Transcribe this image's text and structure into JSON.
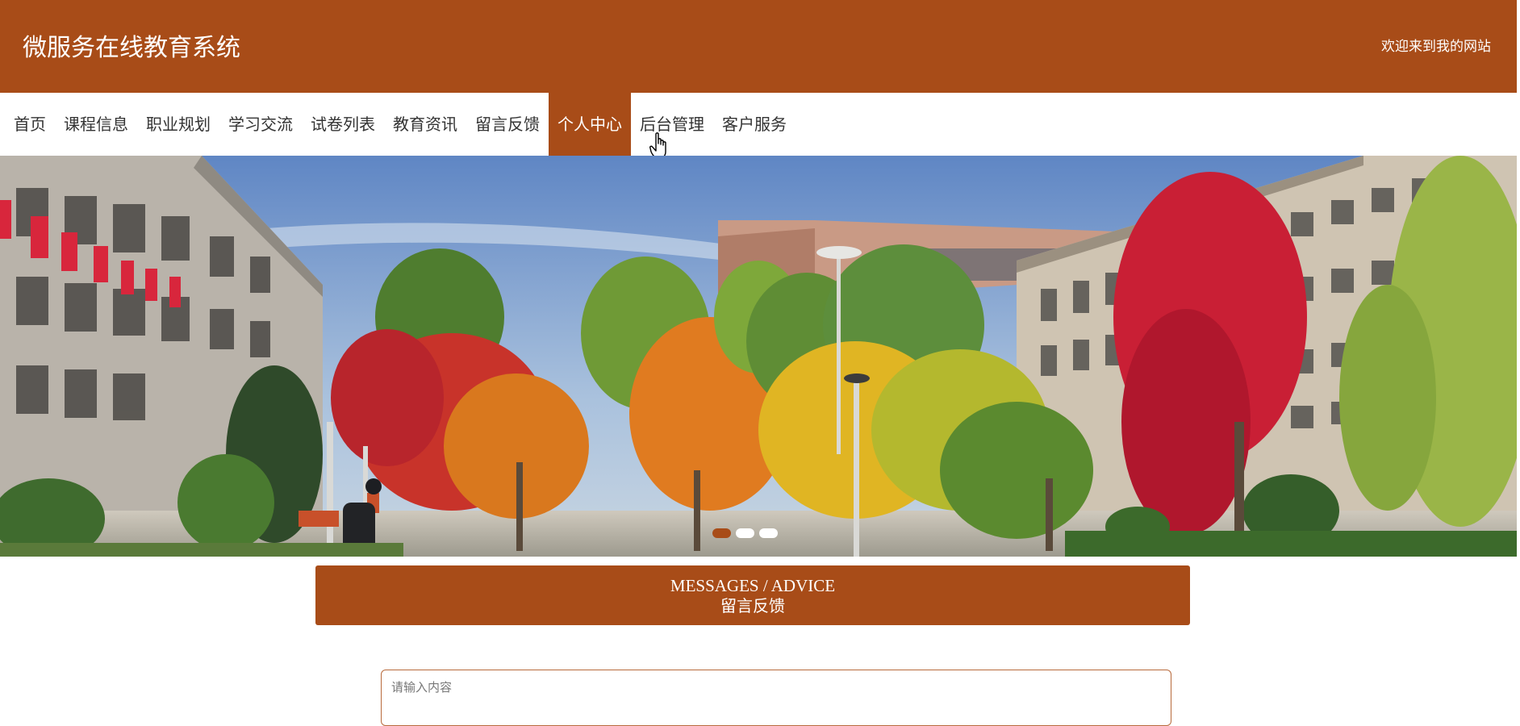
{
  "header": {
    "title": "微服务在线教育系统",
    "welcome": "欢迎来到我的网站"
  },
  "nav": {
    "items": [
      {
        "label": "首页"
      },
      {
        "label": "课程信息"
      },
      {
        "label": "职业规划"
      },
      {
        "label": "学习交流"
      },
      {
        "label": "试卷列表"
      },
      {
        "label": "教育资讯"
      },
      {
        "label": "留言反馈"
      },
      {
        "label": "个人中心"
      },
      {
        "label": "后台管理"
      },
      {
        "label": "客户服务"
      }
    ],
    "active_label": "个人中心"
  },
  "banner": {
    "slide_count": 3,
    "active_slide": 1
  },
  "section": {
    "title_en": "MESSAGES / ADVICE",
    "title_zh": "留言反馈"
  },
  "message_form": {
    "placeholder": "请输入内容"
  },
  "colors": {
    "brand": "#a84c18"
  }
}
